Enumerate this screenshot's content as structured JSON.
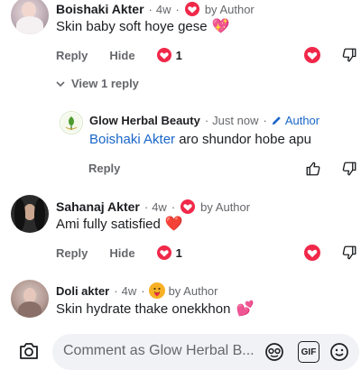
{
  "comments": [
    {
      "name": "Boishaki Akter",
      "time": "4w",
      "sep": "·",
      "author_badge": "by Author",
      "text": "Skin baby soft hoye gese",
      "emoji": "💖",
      "actions": {
        "reply": "Reply",
        "hide": "Hide"
      },
      "reaction_count": "1",
      "view_replies": "View 1 reply"
    },
    {
      "name": "Sahanaj Akter",
      "time": "4w",
      "sep": "·",
      "author_badge": "by Author",
      "text": "Ami fully satisfied",
      "emoji": "❤️",
      "actions": {
        "reply": "Reply",
        "hide": "Hide"
      },
      "reaction_count": "1"
    },
    {
      "name": "Doli akter",
      "time": "4w",
      "sep": "·",
      "author_badge": "by Author",
      "text": "Skin hydrate thake onekkhon",
      "emoji": "💕"
    }
  ],
  "reply": {
    "name": "Glow Herbal Beauty",
    "time": "Just now",
    "sep": "·",
    "author_label": "Author",
    "mention": "Boishaki Akter",
    "text": " aro shundor hobe apu",
    "action_reply": "Reply"
  },
  "composer": {
    "placeholder": "Comment as Glow Herbal B...",
    "gif_label": "GIF"
  },
  "colors": {
    "link_blue": "#1a66c9",
    "love_red": "#f02849",
    "secondary_text": "#65676b"
  }
}
